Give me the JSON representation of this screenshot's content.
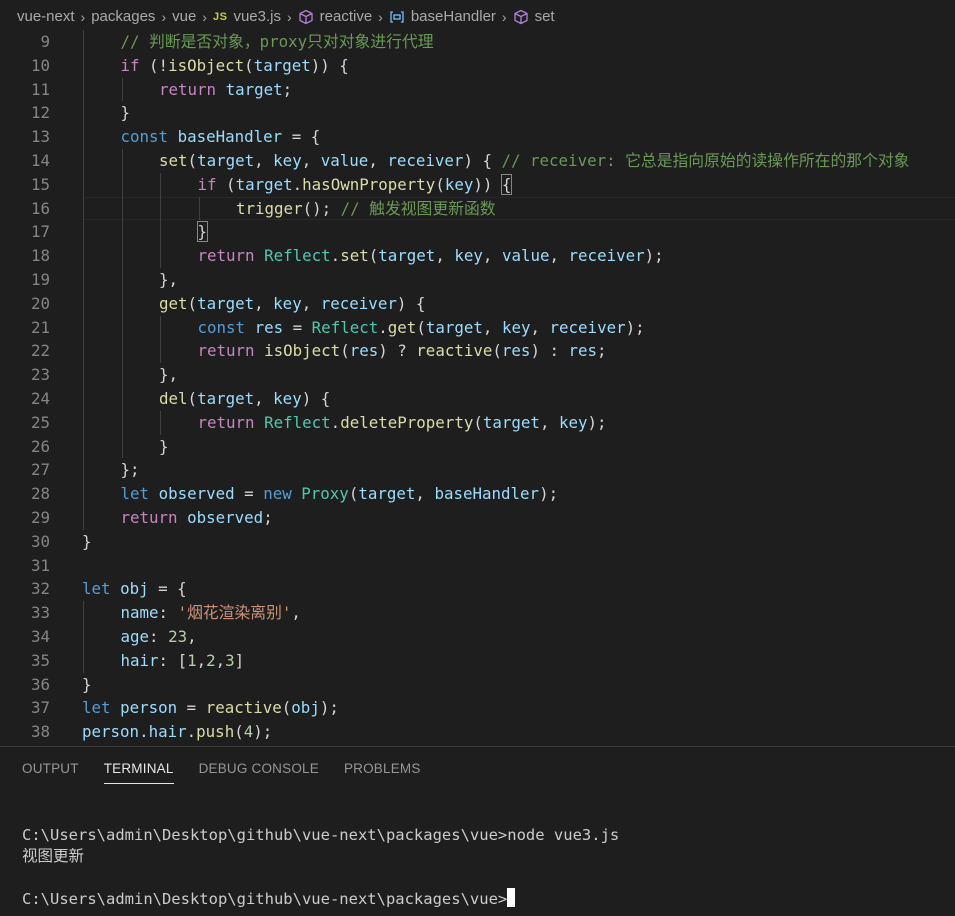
{
  "breadcrumb": {
    "items": [
      "vue-next",
      "packages",
      "vue",
      "vue3.js",
      "reactive",
      "baseHandler",
      "set"
    ],
    "js_badge": "JS"
  },
  "editor": {
    "lines": [
      {
        "n": "9",
        "indent": 1,
        "tokens": [
          [
            "c",
            "// 判断是否对象，proxy只对对象进行代理"
          ]
        ]
      },
      {
        "n": "10",
        "indent": 1,
        "tokens": [
          [
            "kc",
            "if"
          ],
          [
            "p",
            " (!"
          ],
          [
            "f",
            "isObject"
          ],
          [
            "p",
            "("
          ],
          [
            "v",
            "target"
          ],
          [
            "p",
            ")) {"
          ]
        ]
      },
      {
        "n": "11",
        "indent": 2,
        "tokens": [
          [
            "kc",
            "return"
          ],
          [
            "p",
            " "
          ],
          [
            "v",
            "target"
          ],
          [
            "p",
            ";"
          ]
        ]
      },
      {
        "n": "12",
        "indent": 1,
        "tokens": [
          [
            "p",
            "}"
          ]
        ]
      },
      {
        "n": "13",
        "indent": 1,
        "tokens": [
          [
            "k",
            "const"
          ],
          [
            "p",
            " "
          ],
          [
            "v",
            "baseHandler"
          ],
          [
            "p",
            " = {"
          ]
        ]
      },
      {
        "n": "14",
        "indent": 2,
        "tokens": [
          [
            "f",
            "set"
          ],
          [
            "p",
            "("
          ],
          [
            "v",
            "target"
          ],
          [
            "p",
            ", "
          ],
          [
            "v",
            "key"
          ],
          [
            "p",
            ", "
          ],
          [
            "v",
            "value"
          ],
          [
            "p",
            ", "
          ],
          [
            "v",
            "receiver"
          ],
          [
            "p",
            ") { "
          ],
          [
            "c",
            "// receiver: 它总是指向原始的读操作所在的那个对象"
          ]
        ]
      },
      {
        "n": "15",
        "indent": 3,
        "tokens": [
          [
            "kc",
            "if"
          ],
          [
            "p",
            " ("
          ],
          [
            "v",
            "target"
          ],
          [
            "p",
            "."
          ],
          [
            "f",
            "hasOwnProperty"
          ],
          [
            "p",
            "("
          ],
          [
            "v",
            "key"
          ],
          [
            "p",
            ")) "
          ],
          [
            "bm",
            "{"
          ]
        ]
      },
      {
        "n": "16",
        "indent": 4,
        "current": true,
        "tokens": [
          [
            "f",
            "trigger"
          ],
          [
            "p",
            "(); "
          ],
          [
            "c",
            "// 触发视图更新函数"
          ]
        ]
      },
      {
        "n": "17",
        "indent": 3,
        "tokens": [
          [
            "bm",
            "}"
          ]
        ]
      },
      {
        "n": "18",
        "indent": 3,
        "tokens": [
          [
            "kc",
            "return"
          ],
          [
            "p",
            " "
          ],
          [
            "t",
            "Reflect"
          ],
          [
            "p",
            "."
          ],
          [
            "f",
            "set"
          ],
          [
            "p",
            "("
          ],
          [
            "v",
            "target"
          ],
          [
            "p",
            ", "
          ],
          [
            "v",
            "key"
          ],
          [
            "p",
            ", "
          ],
          [
            "v",
            "value"
          ],
          [
            "p",
            ", "
          ],
          [
            "v",
            "receiver"
          ],
          [
            "p",
            ");"
          ]
        ]
      },
      {
        "n": "19",
        "indent": 2,
        "tokens": [
          [
            "p",
            "},"
          ]
        ]
      },
      {
        "n": "20",
        "indent": 2,
        "tokens": [
          [
            "f",
            "get"
          ],
          [
            "p",
            "("
          ],
          [
            "v",
            "target"
          ],
          [
            "p",
            ", "
          ],
          [
            "v",
            "key"
          ],
          [
            "p",
            ", "
          ],
          [
            "v",
            "receiver"
          ],
          [
            "p",
            ") {"
          ]
        ]
      },
      {
        "n": "21",
        "indent": 3,
        "tokens": [
          [
            "k",
            "const"
          ],
          [
            "p",
            " "
          ],
          [
            "v",
            "res"
          ],
          [
            "p",
            " = "
          ],
          [
            "t",
            "Reflect"
          ],
          [
            "p",
            "."
          ],
          [
            "f",
            "get"
          ],
          [
            "p",
            "("
          ],
          [
            "v",
            "target"
          ],
          [
            "p",
            ", "
          ],
          [
            "v",
            "key"
          ],
          [
            "p",
            ", "
          ],
          [
            "v",
            "receiver"
          ],
          [
            "p",
            ");"
          ]
        ]
      },
      {
        "n": "22",
        "indent": 3,
        "tokens": [
          [
            "kc",
            "return"
          ],
          [
            "p",
            " "
          ],
          [
            "f",
            "isObject"
          ],
          [
            "p",
            "("
          ],
          [
            "v",
            "res"
          ],
          [
            "p",
            ") ? "
          ],
          [
            "f",
            "reactive"
          ],
          [
            "p",
            "("
          ],
          [
            "v",
            "res"
          ],
          [
            "p",
            ") : "
          ],
          [
            "v",
            "res"
          ],
          [
            "p",
            ";"
          ]
        ]
      },
      {
        "n": "23",
        "indent": 2,
        "tokens": [
          [
            "p",
            "},"
          ]
        ]
      },
      {
        "n": "24",
        "indent": 2,
        "tokens": [
          [
            "f",
            "del"
          ],
          [
            "p",
            "("
          ],
          [
            "v",
            "target"
          ],
          [
            "p",
            ", "
          ],
          [
            "v",
            "key"
          ],
          [
            "p",
            ") {"
          ]
        ]
      },
      {
        "n": "25",
        "indent": 3,
        "tokens": [
          [
            "kc",
            "return"
          ],
          [
            "p",
            " "
          ],
          [
            "t",
            "Reflect"
          ],
          [
            "p",
            "."
          ],
          [
            "f",
            "deleteProperty"
          ],
          [
            "p",
            "("
          ],
          [
            "v",
            "target"
          ],
          [
            "p",
            ", "
          ],
          [
            "v",
            "key"
          ],
          [
            "p",
            ");"
          ]
        ]
      },
      {
        "n": "26",
        "indent": 2,
        "tokens": [
          [
            "p",
            "}"
          ]
        ]
      },
      {
        "n": "27",
        "indent": 1,
        "tokens": [
          [
            "p",
            "};"
          ]
        ]
      },
      {
        "n": "28",
        "indent": 1,
        "tokens": [
          [
            "k",
            "let"
          ],
          [
            "p",
            " "
          ],
          [
            "v",
            "observed"
          ],
          [
            "p",
            " = "
          ],
          [
            "k",
            "new"
          ],
          [
            "p",
            " "
          ],
          [
            "t",
            "Proxy"
          ],
          [
            "p",
            "("
          ],
          [
            "v",
            "target"
          ],
          [
            "p",
            ", "
          ],
          [
            "v",
            "baseHandler"
          ],
          [
            "p",
            ");"
          ]
        ]
      },
      {
        "n": "29",
        "indent": 1,
        "tokens": [
          [
            "kc",
            "return"
          ],
          [
            "p",
            " "
          ],
          [
            "v",
            "observed"
          ],
          [
            "p",
            ";"
          ]
        ]
      },
      {
        "n": "30",
        "indent": 0,
        "tokens": [
          [
            "p",
            "}"
          ]
        ]
      },
      {
        "n": "31",
        "indent": 0,
        "tokens": []
      },
      {
        "n": "32",
        "indent": 0,
        "tokens": [
          [
            "k",
            "let"
          ],
          [
            "p",
            " "
          ],
          [
            "v",
            "obj"
          ],
          [
            "p",
            " = {"
          ]
        ]
      },
      {
        "n": "33",
        "indent": 1,
        "tokens": [
          [
            "v",
            "name"
          ],
          [
            "p",
            ": "
          ],
          [
            "s",
            "'烟花渲染离别'"
          ],
          [
            "p",
            ","
          ]
        ]
      },
      {
        "n": "34",
        "indent": 1,
        "tokens": [
          [
            "v",
            "age"
          ],
          [
            "p",
            ": "
          ],
          [
            "n",
            "23"
          ],
          [
            "p",
            ","
          ]
        ]
      },
      {
        "n": "35",
        "indent": 1,
        "tokens": [
          [
            "v",
            "hair"
          ],
          [
            "p",
            ": ["
          ],
          [
            "n",
            "1"
          ],
          [
            "p",
            ","
          ],
          [
            "n",
            "2"
          ],
          [
            "p",
            ","
          ],
          [
            "n",
            "3"
          ],
          [
            "p",
            "]"
          ]
        ]
      },
      {
        "n": "36",
        "indent": 0,
        "tokens": [
          [
            "p",
            "}"
          ]
        ]
      },
      {
        "n": "37",
        "indent": 0,
        "tokens": [
          [
            "k",
            "let"
          ],
          [
            "p",
            " "
          ],
          [
            "v",
            "person"
          ],
          [
            "p",
            " = "
          ],
          [
            "f",
            "reactive"
          ],
          [
            "p",
            "("
          ],
          [
            "v",
            "obj"
          ],
          [
            "p",
            ");"
          ]
        ]
      },
      {
        "n": "38",
        "indent": 0,
        "tokens": [
          [
            "v",
            "person"
          ],
          [
            "p",
            "."
          ],
          [
            "v",
            "hair"
          ],
          [
            "p",
            "."
          ],
          [
            "f",
            "push"
          ],
          [
            "p",
            "("
          ],
          [
            "n",
            "4"
          ],
          [
            "p",
            ");"
          ]
        ]
      }
    ]
  },
  "panel": {
    "tabs": [
      {
        "label": "OUTPUT",
        "active": false
      },
      {
        "label": "TERMINAL",
        "active": true
      },
      {
        "label": "DEBUG CONSOLE",
        "active": false
      },
      {
        "label": "PROBLEMS",
        "active": false
      }
    ],
    "terminal": {
      "command_line": "C:\\Users\\admin\\Desktop\\github\\vue-next\\packages\\vue>node vue3.js",
      "output_line": "视图更新",
      "prompt": "C:\\Users\\admin\\Desktop\\github\\vue-next\\packages\\vue>"
    }
  },
  "colors": {
    "background": "#1e1e1e",
    "keyword": "#569cd6",
    "control": "#c586c0",
    "variable": "#9cdcfe",
    "function": "#dcdcaa",
    "type": "#4ec9b0",
    "string": "#ce9178",
    "number": "#b5cea8",
    "comment": "#6a9955"
  }
}
